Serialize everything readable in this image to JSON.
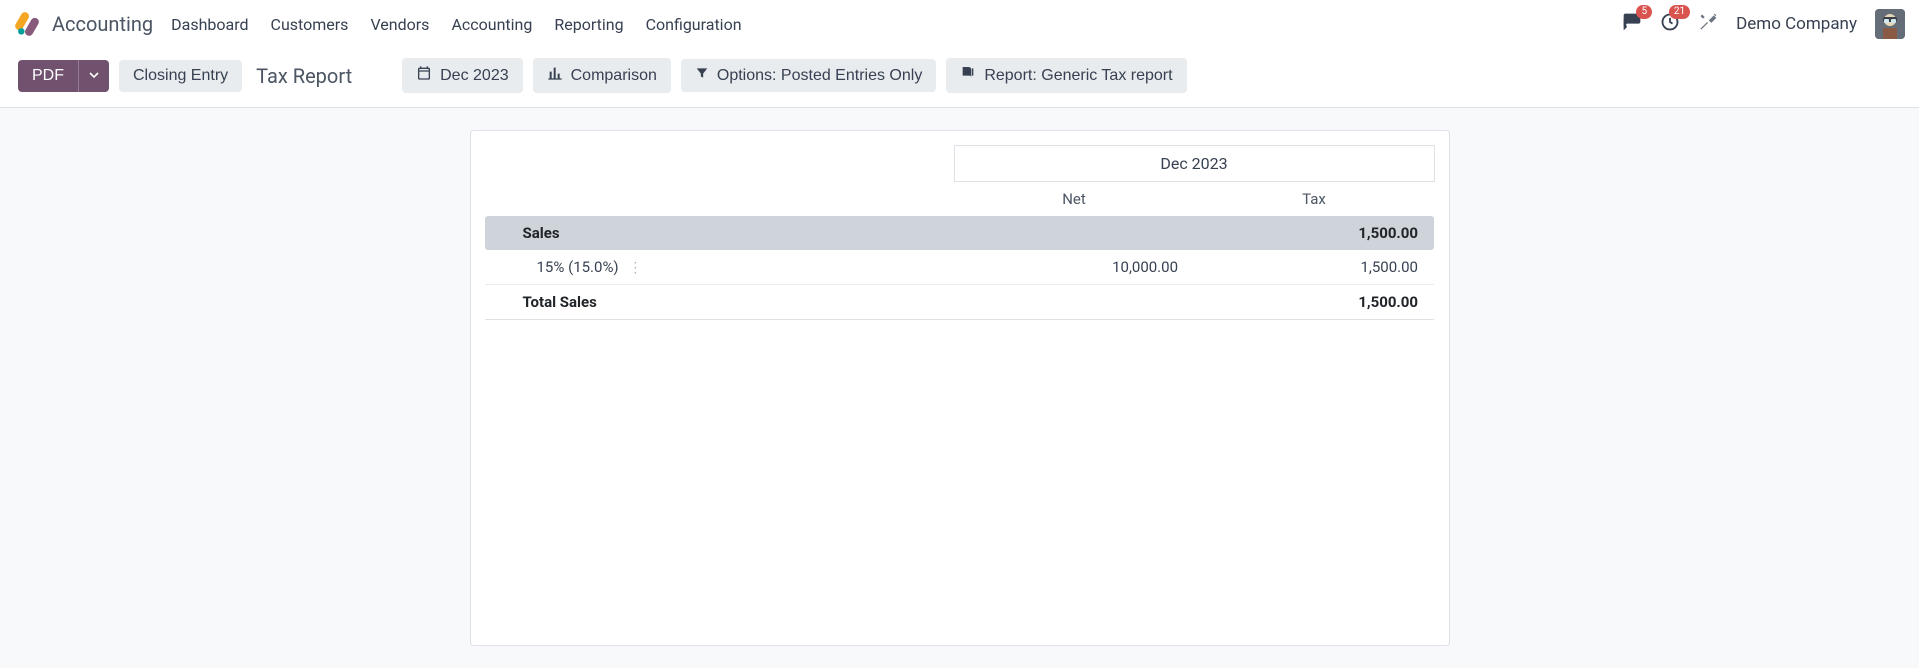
{
  "app_name": "Accounting",
  "nav": {
    "items": [
      "Dashboard",
      "Customers",
      "Vendors",
      "Accounting",
      "Reporting",
      "Configuration"
    ]
  },
  "header": {
    "messages_badge": "5",
    "activities_badge": "21",
    "company": "Demo Company"
  },
  "toolbar": {
    "pdf": "PDF",
    "closing_entry": "Closing Entry",
    "page_title": "Tax Report",
    "date_btn": "Dec 2023",
    "comparison_btn": "Comparison",
    "options_btn": "Options: Posted Entries Only",
    "report_btn": "Report: Generic Tax report"
  },
  "report": {
    "period": "Dec 2023",
    "col_net": "Net",
    "col_tax": "Tax",
    "sales_section": {
      "label": "Sales",
      "tax_total": "1,500.00"
    },
    "rows": [
      {
        "label": "15% (15.0%)",
        "net": "10,000.00",
        "tax": "1,500.00"
      }
    ],
    "totals": {
      "label": "Total Sales",
      "tax": "1,500.00"
    }
  },
  "chart_data": {
    "type": "table",
    "title": "Tax Report — Dec 2023",
    "columns": [
      "",
      "Net",
      "Tax"
    ],
    "rows": [
      [
        "Sales",
        null,
        1500.0
      ],
      [
        "15% (15.0%)",
        10000.0,
        1500.0
      ],
      [
        "Total Sales",
        null,
        1500.0
      ]
    ]
  }
}
